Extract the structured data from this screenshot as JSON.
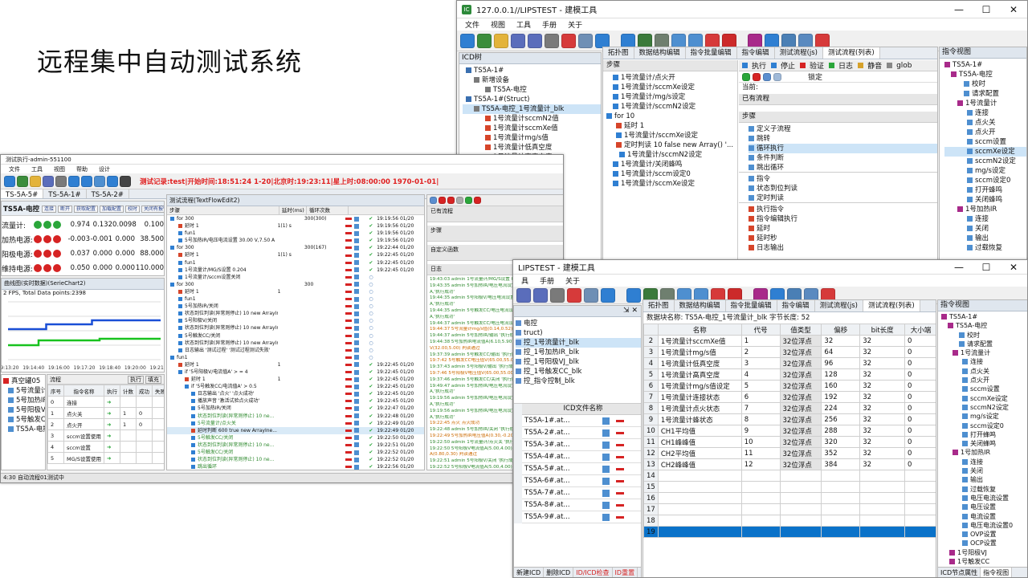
{
  "slide_title": "远程集中自动测试系统",
  "top_window": {
    "title": "127.0.0.1//LIPSTEST - 建模工具",
    "menu": [
      "文件",
      "视图",
      "工具",
      "手册",
      "关于"
    ],
    "icd_tree": {
      "header": "ICD树",
      "items": [
        "TS5A-1#",
        "新增设备",
        "TS5A-电控",
        "TS5A-1#(Struct)",
        "TS5A-电控_1号流量计_blk",
        "1号流量计sccmN2值",
        "1号流量计sccmXe值",
        "1号流量计mg/s值",
        "1号流量计低真空度",
        "1号流量计高真空度"
      ]
    },
    "tabs": [
      "拓扑图",
      "数据结构编辑",
      "指令批量编辑",
      "指令编辑",
      "测试流程(js)",
      "测试流程(列表)"
    ],
    "steps_header": "步骤",
    "steps": [
      "1号流量计/点火开",
      "1号流量计/sccmXe设定",
      "1号流量计/mg/s设定",
      "1号流量计/sccmN2设定",
      "for 10",
      "延时 1",
      "1号流量计/sccmXe设定",
      "定时判读 10 false new Array() '...",
      "1号流量计/sccmN2设定",
      "1号流量计/关闭蜂鸣",
      "1号流量计/sccm设定0",
      "1号流量计/sccmXe设定"
    ],
    "right_toolbar": [
      "执行",
      "停止",
      "验证",
      "日志",
      "静音",
      "glob"
    ],
    "lock_label": "锁定",
    "current_label": "当前:",
    "existing_flow": "已有流程",
    "steps2_header": "步骤",
    "flow_items": [
      "定义子流程",
      "跳转",
      "循环执行",
      "条件判断",
      "跳出循环"
    ],
    "cmd_items": [
      "指令",
      "状态到位判读",
      "定时判读"
    ],
    "exec_items": [
      "执行指令",
      "指令编辑执行",
      "延时",
      "延时秒",
      "日志输出"
    ],
    "cmd_view": {
      "header": "指令视图",
      "items": [
        "TS5A-1#",
        "TS5A-电控",
        "校时",
        "请求配置",
        "1号流量计",
        "连接",
        "点火关",
        "点火开",
        "sccm设置",
        "sccmXe设定",
        "sccmN2设定",
        "mg/s设定",
        "sccm设定0",
        "打开蜂鸣",
        "关闭蜂鸣",
        "1号加热IR",
        "连接",
        "关闭",
        "输出",
        "过载恢复"
      ]
    }
  },
  "left_window": {
    "title": "测试执行-admin-551100",
    "menu": [
      "文件",
      "工具",
      "视图",
      "帮助",
      "设计"
    ],
    "status_line": "测试记录:test|开始时间:18:51:24 1-20|北京时:19:23:11|星上时:08:00:00 1970-01-01|",
    "tabs": [
      "TS-5A-5#",
      "TS-5A-1#",
      "TS-5A-2#"
    ],
    "device_name": "TS5A-电控",
    "device_buttons": [
      "连接",
      "断开",
      "获取配置",
      "加载配置",
      "校时",
      "关闭有报警"
    ],
    "readings": [
      {
        "label": "流量计:",
        "v1": "0.974",
        "v2": "0.132",
        "v3": "0.0098",
        "v4": "0.100"
      },
      {
        "label": "加热电源:",
        "v1": "-0.003",
        "v2": "-0.001",
        "v3": "0.000",
        "v4": "38.500"
      },
      {
        "label": "阳极电源:",
        "v1": "0.037",
        "v2": "0.000",
        "v3": "0.000",
        "v4": "88.000"
      },
      {
        "label": "维持电源:",
        "v1": "0.050",
        "v2": "0.000",
        "v3": "0.000",
        "v4": "110.000"
      }
    ],
    "chart_header": "曲线图(实时数据)(SerieChart2)",
    "chart_info": "2 FPS, Total Data points:2398",
    "chart_x_ticks": [
      "19:13:20",
      "19:14:40",
      "19:16:00",
      "19:17:20",
      "19:18:40",
      "19:20:00",
      "19:21:20"
    ],
    "flow_header": "测试流程(TextFlowEdit2)",
    "flow_cols": [
      "步骤",
      "延时(ms)",
      "循环次数"
    ],
    "flow_rows": [
      {
        "t": "for 300",
        "d": "",
        "c": "300(300)",
        "time": "19:19:56 01/20"
      },
      {
        "t": "延时 1",
        "d": "1(1) s",
        "c": "",
        "time": "19:19:56 01/20"
      },
      {
        "t": "fun1",
        "d": "",
        "c": "",
        "time": "19:19:56 01/20"
      },
      {
        "t": "5号加热IR/电压电流设置 30.00 V,7.50 A",
        "d": "",
        "c": "",
        "time": "19:19:56 01/20"
      },
      {
        "t": "for 300",
        "d": "",
        "c": "300(167)",
        "time": "19:22:44 01/20"
      },
      {
        "t": "延时 1",
        "d": "1(1) s",
        "c": "",
        "time": "19:22:45 01/20"
      },
      {
        "t": "fun1",
        "d": "",
        "c": "",
        "time": "19:22:45 01/20"
      },
      {
        "t": "1号流量计/MG/S设置 0.204",
        "d": "",
        "c": "",
        "time": "19:22:45 01/20"
      },
      {
        "t": "1号流量计/sccm设置关闭",
        "d": "",
        "c": "",
        "time": ""
      },
      {
        "t": "for 300",
        "d": "",
        "c": "300",
        "time": ""
      },
      {
        "t": "延时 1",
        "d": "1",
        "c": "",
        "time": ""
      },
      {
        "t": "fun1",
        "d": "",
        "c": "",
        "time": ""
      },
      {
        "t": "5号加热IR/关闭",
        "d": "",
        "c": "",
        "time": ""
      },
      {
        "t": "状态到位判读(异常则停止) 10 new ArrayIne...",
        "d": "",
        "c": "",
        "time": ""
      },
      {
        "t": "5号阳极V/关闭",
        "d": "",
        "c": "",
        "time": ""
      },
      {
        "t": "状态到位判读(异常则停止) 10 new ArrayIne...",
        "d": "",
        "c": "",
        "time": ""
      },
      {
        "t": "5号触发CC/关闭",
        "d": "",
        "c": "",
        "time": ""
      },
      {
        "t": "状态到位判读(异常则停止) 10 new ArrayIne...",
        "d": "",
        "c": "",
        "time": ""
      },
      {
        "t": "日志输出 '测试过程' '测试过程测试失败'",
        "d": "",
        "c": "",
        "time": ""
      },
      {
        "t": "fun1",
        "d": "",
        "c": "",
        "time": ""
      },
      {
        "t": "延时 1",
        "d": "1",
        "c": "",
        "time": "19:22:45 01/20"
      },
      {
        "t": "if '5号阳极V/电流值A' > = 4",
        "d": "",
        "c": "",
        "time": "19:22:45 01/20"
      },
      {
        "t": "延时 1",
        "d": "1",
        "c": "",
        "time": "19:22:45 01/20"
      },
      {
        "t": "if '5号触发CC/电流值A' > 0.5",
        "d": "",
        "c": "",
        "time": "19:22:45 01/20"
      },
      {
        "t": "日志输出 '点火' '点火成功'",
        "d": "",
        "c": "",
        "time": "19:22:45 01/20"
      },
      {
        "t": "播放声音 '激活试验点火成功'",
        "d": "",
        "c": "",
        "time": "19:22:45 01/20"
      },
      {
        "t": "5号加热IR/关闭",
        "d": "",
        "c": "",
        "time": "19:22:47 01/20"
      },
      {
        "t": "状态到位判读(异常则停止) 10 ne...",
        "d": "",
        "c": "",
        "time": "19:22:48 01/20"
      },
      {
        "t": "5号流量计/点火关",
        "d": "",
        "c": "",
        "time": "19:22:49 01/20"
      },
      {
        "t": "延时判断 600 true new ArrayIne...",
        "d": "",
        "c": "",
        "time": "19:22:49 01/20"
      },
      {
        "t": "5号触发CC/关闭",
        "d": "",
        "c": "",
        "time": "19:22:50 01/20"
      },
      {
        "t": "状态到位判读(异常则停止) 10 ne...",
        "d": "",
        "c": "",
        "time": "19:22:51 01/20"
      },
      {
        "t": "5号触发CC/关闭",
        "d": "",
        "c": "",
        "time": "19:22:52 01/20"
      },
      {
        "t": "状态到位判读(异常则停止) 10 ne...",
        "d": "",
        "c": "",
        "time": "19:22:52 01/20"
      },
      {
        "t": "跳出循环",
        "d": "",
        "c": "",
        "time": "19:22:56 01/20"
      }
    ],
    "right_sections": [
      "已有流程",
      "步骤",
      "自定义函数",
      "日志"
    ],
    "logs": [
      "19:43:03 admin 1号流量计/MG/S设置 0.139,'执行成功'",
      "19:43:35 admin 5号加热IR/电压电流设置 30.00 V,6.00",
      "A,'执行成功'",
      "19:44:35 admin 5号阳极V/电压电流设置 60.00 V,4.60",
      "A,'执行成功'",
      "19:44:35 admin 5号触发CC/电压电流设置 30.00 V,6.00",
      "A,'执行成功'",
      "19:44:37 admin 5号触发CC/电压电流设置 '执行成功'",
      "19:44:37 5号流量计mg/s值(0.14,0.52) 判读通过",
      "19:44:37 admin 5号加热IR/输出 '执行成功'",
      "19:44:38 5号加热IR电流值A(6.10,5.90)5号加热IR电压值",
      "V(32.00,5.00) 判读通过",
      "19:37:39 admin 5号触发CC/输出 '执行成功'",
      "19:7:42 5号触发CC电压值V(65.00,55.00) 判读通过",
      "19:37:43 admin 5号阳极V/输出 '执行成功'",
      "19:7:46 5号阳极V电压值V(65.00,55.00) 判读通过",
      "19:37:46 admin 5号触发CC/关闭 '执行成功'",
      "19:49:47 admin 5号加热IR/电压电流设置 30.00 V,6.50",
      "A,'执行成功'",
      "19:19:56 admin 5号加热IR/电压电流设置 30.00 V,7.00",
      "A,'执行成功'",
      "19:19:56 admin 5号加热IR/电压电流设置 30.00 V,7.50",
      "A,'执行成功'",
      "19:22:45 点火 点火成功",
      "19:22:48 admin 5号加热IR/关闭 '执行成功'",
      "19:22:49 5号加热IR电压值A(0.30,-0.20) 判读通过",
      "19:22:50 admin 1号流量计/点火关 '执行成功'",
      "19:22:50 5号阳极V电流值A(5.00,4.00)5号触发CC电流值",
      "A(0.80,0.30) 判读通过",
      "19:22:51 admin 5号阳极V/关闭 '执行成功'",
      "19:22:52 5号阳极V电流值A(5.00,4.00)5号触发CC电流值",
      "A(0.80,0.30) 判读通过"
    ],
    "bottom_tree_items": [
      "真空罐05",
      "5号流量计",
      "5号加热IR",
      "5号阳极V",
      "5号触发CC",
      "TS5A-电控"
    ],
    "bottom_flow_label": "流程",
    "bottom_buttons": [
      "执行",
      "填充"
    ],
    "bottom_cols": [
      "序号",
      "指令名称",
      "执行",
      "计数",
      "成功",
      "失败"
    ],
    "bottom_rows": [
      {
        "n": "0",
        "name": "连接",
        "c": "",
        "ok": "",
        "f": ""
      },
      {
        "n": "1",
        "name": "点火关",
        "c": "1",
        "ok": "0",
        "f": ""
      },
      {
        "n": "2",
        "name": "点火开",
        "c": "1",
        "ok": "0",
        "f": ""
      },
      {
        "n": "3",
        "name": "sccm设置使用",
        "c": "",
        "ok": "",
        "f": ""
      },
      {
        "n": "4",
        "name": "sccm设置",
        "c": "",
        "ok": "",
        "f": ""
      },
      {
        "n": "5",
        "name": "MG/S设置使用",
        "c": "",
        "ok": "",
        "f": ""
      }
    ],
    "statusbar": "4:30 自动流程01测试中"
  },
  "bottom_window": {
    "title": "LIPSTEST - 建模工具",
    "menu": [
      "具",
      "手册",
      "关于"
    ],
    "tabs": [
      "拓扑图",
      "数据结构编辑",
      "指令批量编辑",
      "指令编辑",
      "测试流程(js)",
      "测试流程(列表)"
    ],
    "block_info": "数据块名称: TS5A-电控_1号流量计_blk 字节长度: 52",
    "cols": [
      "名称",
      "代号",
      "值类型",
      "偏移",
      "bit长度",
      "大小端"
    ],
    "rows": [
      {
        "name": "1号流量计sccmXe值",
        "code": "1",
        "type": "32位浮点",
        "off": "32",
        "bits": "32",
        "end": "0"
      },
      {
        "name": "1号流量计mg/s值",
        "code": "2",
        "type": "32位浮点",
        "off": "64",
        "bits": "32",
        "end": "0"
      },
      {
        "name": "1号流量计低真空度",
        "code": "3",
        "type": "32位浮点",
        "off": "96",
        "bits": "32",
        "end": "0"
      },
      {
        "name": "1号流量计高真空度",
        "code": "4",
        "type": "32位浮点",
        "off": "128",
        "bits": "32",
        "end": "0"
      },
      {
        "name": "1号流量计mg/s值设定",
        "code": "5",
        "type": "32位浮点",
        "off": "160",
        "bits": "32",
        "end": "0"
      },
      {
        "name": "1号流量计连接状态",
        "code": "6",
        "type": "32位浮点",
        "off": "192",
        "bits": "32",
        "end": "0"
      },
      {
        "name": "1号流量计点火状态",
        "code": "7",
        "type": "32位浮点",
        "off": "224",
        "bits": "32",
        "end": "0"
      },
      {
        "name": "1号流量计蜂状态",
        "code": "8",
        "type": "32位浮点",
        "off": "256",
        "bits": "32",
        "end": "0"
      },
      {
        "name": "CH1平均值",
        "code": "9",
        "type": "32位浮点",
        "off": "288",
        "bits": "32",
        "end": "0"
      },
      {
        "name": "CH1峰峰值",
        "code": "10",
        "type": "32位浮点",
        "off": "320",
        "bits": "32",
        "end": "0"
      },
      {
        "name": "CH2平均值",
        "code": "11",
        "type": "32位浮点",
        "off": "352",
        "bits": "32",
        "end": "0"
      },
      {
        "name": "CH2峰峰值",
        "code": "12",
        "type": "32位浮点",
        "off": "384",
        "bits": "32",
        "end": "0"
      }
    ],
    "left_tree": [
      "电控",
      "truct)",
      "控_1号流量计_blk",
      "控_1号加热IR_blk",
      "控_1号阳极VJ_blk",
      "控_1号触发CC_blk",
      "控_指令控制_blk"
    ],
    "icd_header": "ICD文件名称",
    "icd_rows": [
      "TS5A-1#.at...",
      "TS5A-2#.at...",
      "TS5A-3#.at...",
      "TS5A-4#.at...",
      "TS5A-5#.at...",
      "TS5A-6#.at...",
      "TS5A-7#.at...",
      "TS5A-8#.at...",
      "TS5A-9#.at..."
    ],
    "icd_left_nums": [
      "5",
      "6",
      "7",
      "8",
      "9"
    ],
    "left_bottom_tabs": [
      "新建ICD",
      "删除ICD",
      "ID/ICD检查",
      "ID重置"
    ],
    "cmd_header": "指令视图",
    "cmd_items": [
      "TS5A-1#",
      "TS5A-电控",
      "校时",
      "请求配置",
      "1号流量计",
      "连接",
      "点火关",
      "点火开",
      "sccm设置",
      "sccmXe设定",
      "sccmN2设定",
      "mg/s设定",
      "sccm设定0",
      "打开蜂鸣",
      "关闭蜂鸣",
      "1号加热IR",
      "连接",
      "关闭",
      "输出",
      "过载恢复",
      "电压电流设置",
      "电压设置",
      "电流设置",
      "电压电流设置0",
      "OVP设置",
      "OCP设置",
      "1号阳极VJ",
      "1号触发CC"
    ],
    "bottom_tabs": [
      "ICD节点属性",
      "指令视图"
    ]
  },
  "colors": {
    "accent": "#0a72c9",
    "ok": "#2aa63a",
    "error": "#d62323",
    "log_green": "#2f8a2f"
  }
}
